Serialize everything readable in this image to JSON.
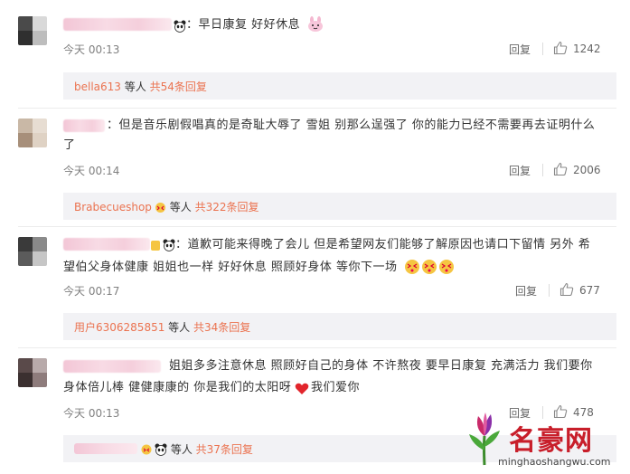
{
  "comments": [
    {
      "text_lines": [
        "：早日康复 好好休息"
      ],
      "trail_emoji": "bunny",
      "time": "今天 00:13",
      "reply_label": "回复",
      "likes": "1242",
      "sub_user": "bella613",
      "sub_mid": " 等人 ",
      "sub_count": "共54条回复"
    },
    {
      "text_lines": [
        "：但是音乐剧假唱真的是奇耻大辱了 雪姐 别那么逞强了 你的能力已经不需要再去证明什么",
        "了"
      ],
      "time": "今天 00:14",
      "reply_label": "回复",
      "likes": "2006",
      "sub_user": "Brabecueshop",
      "sub_mid": " 等人 ",
      "sub_count": "共322条回复"
    },
    {
      "text_lines": [
        "：道歉可能来得晚了会儿 但是希望网友们能够了解原因也请口下留情 另外 希",
        "望伯父身体健康 姐姐也一样 好好休息 照顾好身体 等你下一场"
      ],
      "time": "今天 00:17",
      "reply_label": "回复",
      "likes": "677",
      "sub_user": "用户6306285851",
      "sub_mid": " 等人 ",
      "sub_count": "共34条回复"
    },
    {
      "text_lines": [
        "姐姐多多注意休息 照顾好自己的身体 不许熬夜 要早日康复 充满活力 我们要你",
        "身体倍儿棒 健健康康的 你是我们的太阳呀",
        "我们爱你"
      ],
      "time": "今天 00:13",
      "reply_label": "回复",
      "likes": "478",
      "sub_user": "",
      "sub_mid": " 等人 ",
      "sub_count": "共37条回复"
    }
  ],
  "watermark": {
    "title": "名豪网",
    "url": "minghaoshangwu.com"
  },
  "colors": {
    "link_orange": "#eb7350",
    "sub_bg": "#f2f2f5",
    "time_gray": "#808080"
  }
}
